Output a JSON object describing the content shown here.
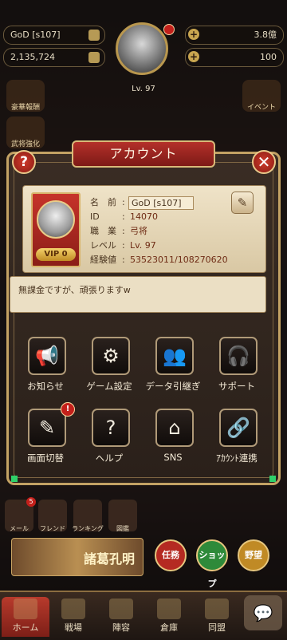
{
  "topbar": {
    "player_name": "GoD [s107]",
    "power": "2,135,724",
    "gold": "3.8億",
    "stamina": "100",
    "level": "Lv. 97"
  },
  "side_events": [
    "豪華報酬",
    "武将強化",
    "イベント"
  ],
  "modal": {
    "title": "アカウント",
    "help_label": "?",
    "close_label": "✕",
    "profile": {
      "vip": "VIP 0",
      "rows": [
        {
          "label": "名　前",
          "value": "GoD [s107]"
        },
        {
          "label": "ID",
          "value": "14070"
        },
        {
          "label": "職　業",
          "value": "弓将"
        },
        {
          "label": "レベル",
          "value": "Lv. 97"
        },
        {
          "label": "経験値",
          "value": "53523011/108270620"
        }
      ]
    },
    "comment": "無課金ですが、頑張りますw",
    "menu": [
      {
        "label": "お知らせ",
        "icon": "megaphone-icon",
        "glyph": "📢"
      },
      {
        "label": "ゲーム設定",
        "icon": "gear-icon",
        "glyph": "⚙"
      },
      {
        "label": "データ引継ぎ",
        "icon": "users-transfer-icon",
        "glyph": "👥"
      },
      {
        "label": "サポート",
        "icon": "headset-icon",
        "glyph": "🎧"
      },
      {
        "label": "画面切替",
        "icon": "screen-switch-icon",
        "glyph": "✎",
        "badge": "!"
      },
      {
        "label": "ヘルプ",
        "icon": "help-scroll-icon",
        "glyph": "?"
      },
      {
        "label": "SNS",
        "icon": "home-icon",
        "glyph": "⌂"
      },
      {
        "label": "ｱｶｳﾝﾄ連携",
        "icon": "account-link-icon",
        "glyph": "🔗"
      }
    ]
  },
  "quickbar": [
    {
      "label": "メール",
      "badge": "5"
    },
    {
      "label": "フレンド"
    },
    {
      "label": "ランキング"
    },
    {
      "label": "図鑑"
    }
  ],
  "banner_text": "諸葛孔明",
  "pills": [
    {
      "label": "任務",
      "color": "#b52a22"
    },
    {
      "label": "ショップ",
      "color": "#2e8a3a"
    },
    {
      "label": "野望",
      "color": "#c08a25"
    }
  ],
  "tabs": [
    "ホーム",
    "戦場",
    "陣容",
    "倉庫",
    "同盟"
  ]
}
